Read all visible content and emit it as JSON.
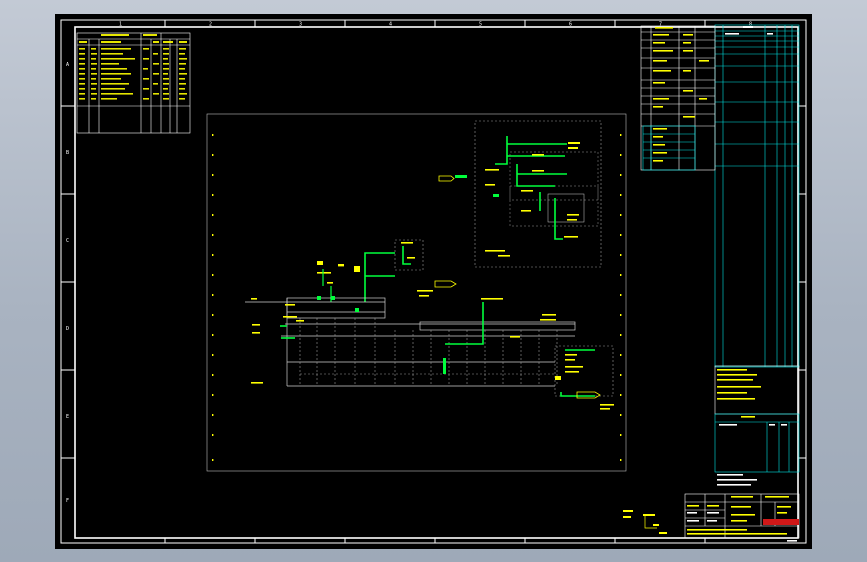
{
  "window": {
    "canvas_background": "#000000",
    "chrome_background": "#b4bcc8"
  },
  "colors": {
    "frame": "#ffffff",
    "pipe": "#00ff3c",
    "text": "#ffff00",
    "table_lines": "#00e5e5",
    "dashed": "#9a9a9a",
    "structure": "#cfcfcf"
  },
  "drawing": {
    "zone_numbers": [
      "1",
      "2",
      "3",
      "4",
      "5",
      "6",
      "7",
      "8"
    ],
    "zone_letters": [
      "A",
      "B",
      "C",
      "D",
      "E",
      "F"
    ],
    "content": "illegible",
    "note": ""
  }
}
